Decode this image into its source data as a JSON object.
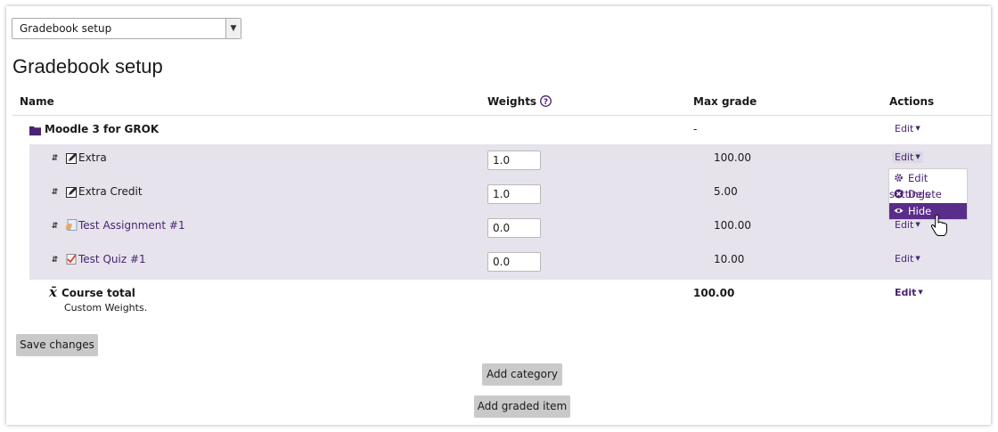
{
  "page_select": {
    "value": "Gradebook setup"
  },
  "title": "Gradebook setup",
  "columns": {
    "name": "Name",
    "weights": "Weights",
    "max_grade": "Max grade",
    "actions": "Actions"
  },
  "category": {
    "name": "Moodle 3 for GROK",
    "max_grade": "-",
    "action": "Edit"
  },
  "items": [
    {
      "name": "Extra",
      "weight": "1.0",
      "max_grade": "100.00",
      "action": "Edit",
      "icon": "manual-grade-icon"
    },
    {
      "name": "Extra Credit",
      "weight": "1.0",
      "max_grade": "5.00",
      "action": "",
      "icon": "manual-grade-icon"
    },
    {
      "name": "Test Assignment #1",
      "weight": "0.0",
      "max_grade": "100.00",
      "action": "Edit",
      "icon": "assignment-icon"
    },
    {
      "name": "Test Quiz #1",
      "weight": "0.0",
      "max_grade": "10.00",
      "action": "Edit",
      "icon": "quiz-icon"
    }
  ],
  "total": {
    "name": "Course total",
    "sub": "Custom Weights.",
    "max_grade": "100.00",
    "action": "Edit"
  },
  "menu": {
    "edit_settings": "Edit settings",
    "delete": "Delete",
    "hide": "Hide"
  },
  "buttons": {
    "save": "Save changes",
    "add_category": "Add category",
    "add_item": "Add graded item"
  },
  "colors": {
    "accent": "#4a2373",
    "menu_active": "#5a2d8a",
    "row_shade": "#e6e3ec",
    "button": "#c9c9c9"
  }
}
